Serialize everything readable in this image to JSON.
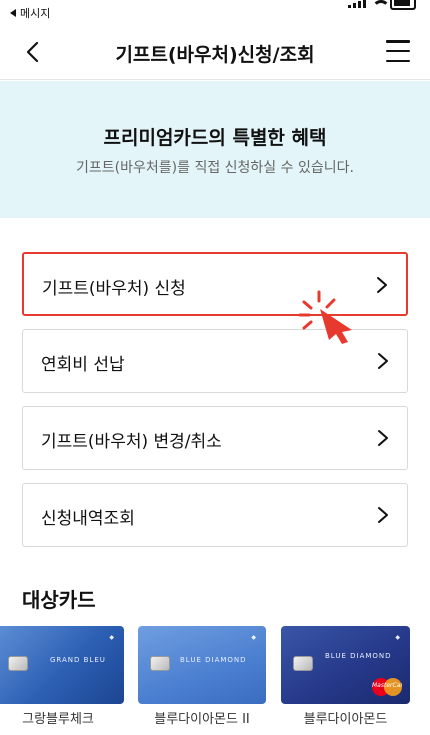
{
  "status_bar": {
    "back_app": "메시지"
  },
  "header": {
    "title": "기프트(바우처)신청/조회"
  },
  "banner": {
    "title": "프리미엄카드의 특별한 혜택",
    "subtitle": "기프트(바우처를)를 직접 신청하실 수 있습니다."
  },
  "menu": {
    "items": [
      {
        "label": "기프트(바우처) 신청",
        "highlighted": true
      },
      {
        "label": "연회비 선납"
      },
      {
        "label": "기프트(바우처) 변경/취소"
      },
      {
        "label": "신청내역조회"
      }
    ]
  },
  "cards_section": {
    "title": "대상카드",
    "cards": [
      {
        "name": "그랑블루체크",
        "brand_text": "GRAND BLEU"
      },
      {
        "name": "블루다이아몬드 II",
        "brand_text": "BLUE DIAMOND"
      },
      {
        "name": "블루다이아몬드",
        "brand_text": "BLUE DIAMOND",
        "network_logo": "MasterCard"
      }
    ]
  },
  "colors": {
    "banner_bg": "#e3f5f8",
    "highlight_border": "#e8392f",
    "pointer": "#e8392f"
  }
}
